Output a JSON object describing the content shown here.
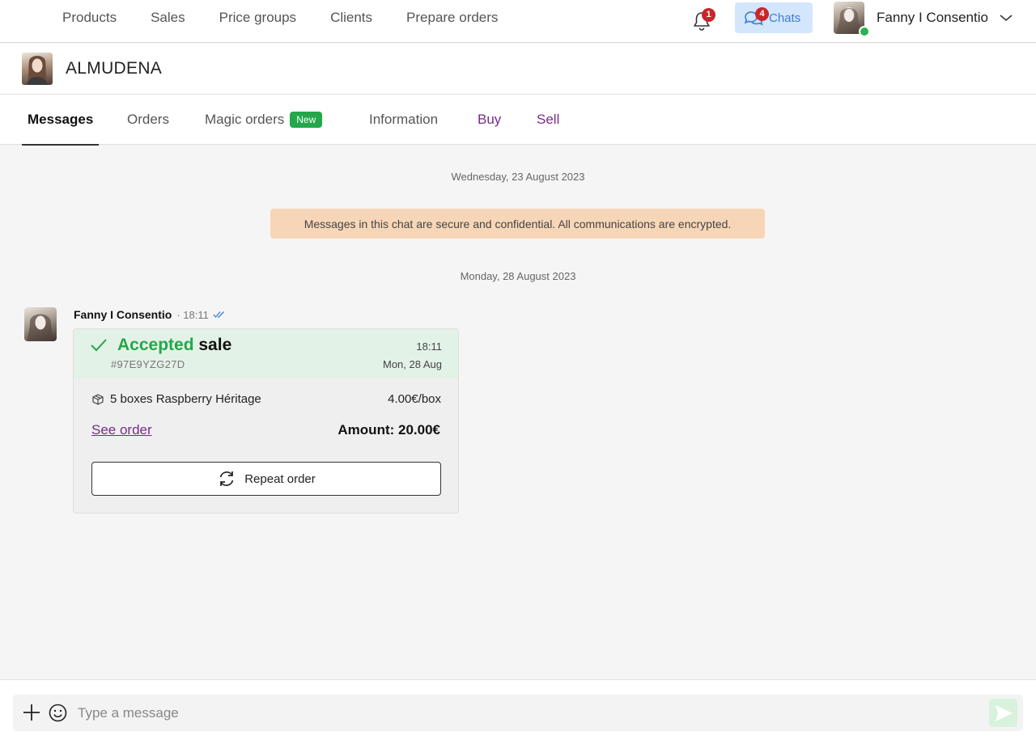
{
  "nav": {
    "items": [
      "Products",
      "Sales",
      "Price groups",
      "Clients",
      "Prepare orders"
    ],
    "notifications_count": "1",
    "chats_count": "4",
    "chats_label": "Chats",
    "user_name": "Fanny I Consentio"
  },
  "contact": {
    "name": "ALMUDENA"
  },
  "tabs": {
    "messages": "Messages",
    "orders": "Orders",
    "magic_orders": "Magic orders",
    "new_badge": "New",
    "information": "Information",
    "buy": "Buy",
    "sell": "Sell"
  },
  "chat": {
    "date1": "Wednesday, 23 August 2023",
    "notice": "Messages in this chat are secure and confidential. All communications are encrypted.",
    "date2": "Monday, 28 August 2023",
    "message": {
      "author": "Fanny I Consentio",
      "time": "· 18:11",
      "card": {
        "status_word": "Accepted",
        "status_type": "sale",
        "order_id": "#97E9YZG27D",
        "time": "18:11",
        "date": "Mon, 28 Aug",
        "item_label": "5 boxes Raspberry Héritage",
        "item_price": "4.00€/box",
        "see_order": "See order",
        "amount": "Amount: 20.00€",
        "repeat_label": "Repeat order"
      }
    }
  },
  "composer": {
    "placeholder": "Type a message"
  },
  "colors": {
    "accent_green": "#23a74a",
    "link_purple": "#7a2a8c",
    "badge_red": "#c9262c",
    "chats_bg": "#d4e6fb",
    "notice_bg": "#f7d6b7"
  }
}
